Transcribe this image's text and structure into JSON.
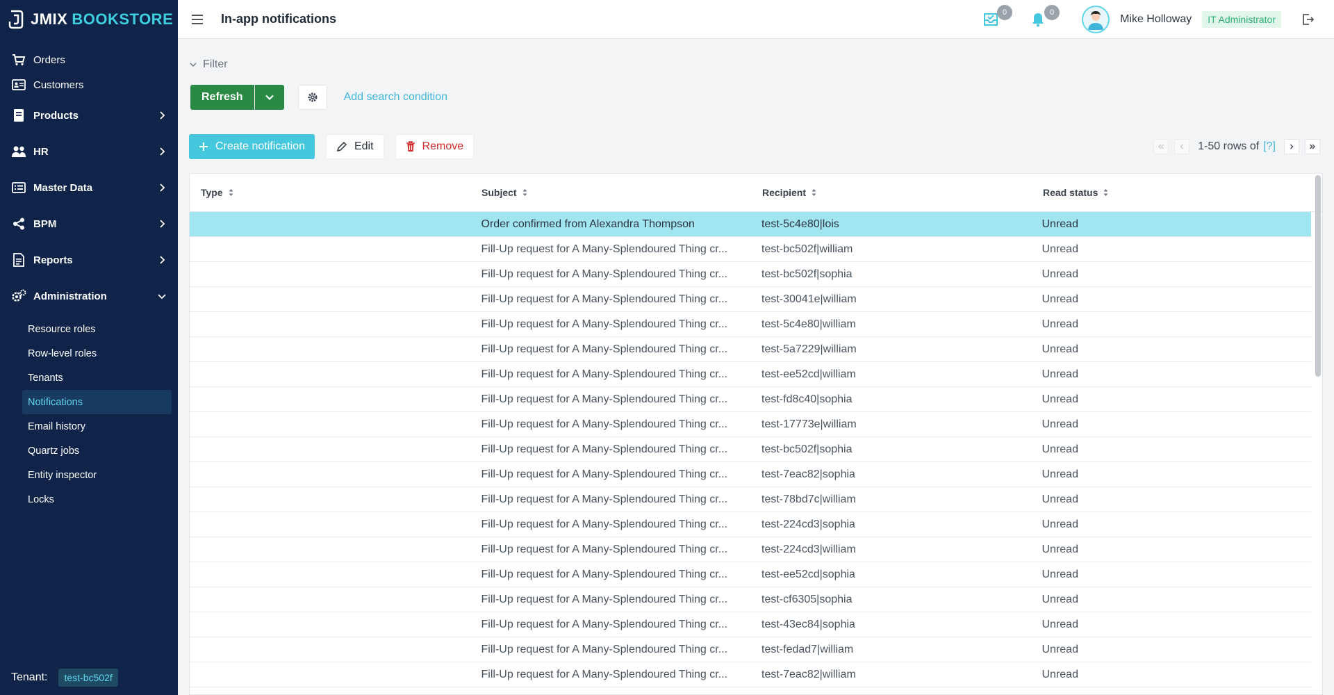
{
  "app": {
    "logo_word1": "JMIX",
    "logo_word2": "BOOKSTORE"
  },
  "sidebar": {
    "items": [
      {
        "label": "Orders",
        "icon": "cart-icon"
      },
      {
        "label": "Customers",
        "icon": "id-card-icon"
      }
    ],
    "groups": [
      {
        "label": "Products",
        "icon": "book-icon"
      },
      {
        "label": "HR",
        "icon": "users-icon"
      },
      {
        "label": "Master Data",
        "icon": "list-icon"
      },
      {
        "label": "BPM",
        "icon": "share-icon"
      },
      {
        "label": "Reports",
        "icon": "report-icon"
      },
      {
        "label": "Administration",
        "icon": "cogs-icon"
      }
    ],
    "admin_items": [
      "Resource roles",
      "Row-level roles",
      "Tenants",
      "Notifications",
      "Email history",
      "Quartz jobs",
      "Entity inspector",
      "Locks"
    ],
    "active_item": "Notifications",
    "tenant_label": "Tenant:",
    "tenant_value": "test-bc502f"
  },
  "header": {
    "title": "In-app notifications",
    "inbox_count": "0",
    "bell_count": "0",
    "user_name": "Mike Holloway",
    "role": "IT Administrator"
  },
  "filter": {
    "label": "Filter",
    "refresh_label": "Refresh",
    "add_condition_label": "Add search condition"
  },
  "toolbar": {
    "create_label": "Create notification",
    "edit_label": "Edit",
    "remove_label": "Remove"
  },
  "pager": {
    "range_text": "1-50 rows of",
    "total_link": "[?]"
  },
  "grid": {
    "columns": [
      "Type",
      "Subject",
      "Recipient",
      "Read status"
    ],
    "rows": [
      {
        "type": "",
        "subject": "Order confirmed from Alexandra Thompson",
        "recipient": "test-5c4e80|lois",
        "status": "Unread"
      },
      {
        "type": "",
        "subject": "Fill-Up request for A Many-Splendoured Thing cr...",
        "recipient": "test-bc502f|william",
        "status": "Unread"
      },
      {
        "type": "",
        "subject": "Fill-Up request for A Many-Splendoured Thing cr...",
        "recipient": "test-bc502f|sophia",
        "status": "Unread"
      },
      {
        "type": "",
        "subject": "Fill-Up request for A Many-Splendoured Thing cr...",
        "recipient": "test-30041e|william",
        "status": "Unread"
      },
      {
        "type": "",
        "subject": "Fill-Up request for A Many-Splendoured Thing cr...",
        "recipient": "test-5c4e80|william",
        "status": "Unread"
      },
      {
        "type": "",
        "subject": "Fill-Up request for A Many-Splendoured Thing cr...",
        "recipient": "test-5a7229|william",
        "status": "Unread"
      },
      {
        "type": "",
        "subject": "Fill-Up request for A Many-Splendoured Thing cr...",
        "recipient": "test-ee52cd|william",
        "status": "Unread"
      },
      {
        "type": "",
        "subject": "Fill-Up request for A Many-Splendoured Thing cr...",
        "recipient": "test-fd8c40|sophia",
        "status": "Unread"
      },
      {
        "type": "",
        "subject": "Fill-Up request for A Many-Splendoured Thing cr...",
        "recipient": "test-17773e|william",
        "status": "Unread"
      },
      {
        "type": "",
        "subject": "Fill-Up request for A Many-Splendoured Thing cr...",
        "recipient": "test-bc502f|sophia",
        "status": "Unread"
      },
      {
        "type": "",
        "subject": "Fill-Up request for A Many-Splendoured Thing cr...",
        "recipient": "test-7eac82|sophia",
        "status": "Unread"
      },
      {
        "type": "",
        "subject": "Fill-Up request for A Many-Splendoured Thing cr...",
        "recipient": "test-78bd7c|william",
        "status": "Unread"
      },
      {
        "type": "",
        "subject": "Fill-Up request for A Many-Splendoured Thing cr...",
        "recipient": "test-224cd3|sophia",
        "status": "Unread"
      },
      {
        "type": "",
        "subject": "Fill-Up request for A Many-Splendoured Thing cr...",
        "recipient": "test-224cd3|william",
        "status": "Unread"
      },
      {
        "type": "",
        "subject": "Fill-Up request for A Many-Splendoured Thing cr...",
        "recipient": "test-ee52cd|sophia",
        "status": "Unread"
      },
      {
        "type": "",
        "subject": "Fill-Up request for A Many-Splendoured Thing cr...",
        "recipient": "test-cf6305|sophia",
        "status": "Unread"
      },
      {
        "type": "",
        "subject": "Fill-Up request for A Many-Splendoured Thing cr...",
        "recipient": "test-43ec84|sophia",
        "status": "Unread"
      },
      {
        "type": "",
        "subject": "Fill-Up request for A Many-Splendoured Thing cr...",
        "recipient": "test-fedad7|william",
        "status": "Unread"
      },
      {
        "type": "",
        "subject": "Fill-Up request for A Many-Splendoured Thing cr...",
        "recipient": "test-7eac82|william",
        "status": "Unread"
      }
    ],
    "selected_row": 0
  },
  "colors": {
    "sidebar_bg": "#0f2448",
    "accent": "#45c7dd",
    "refresh_green": "#2a8a43",
    "remove_red": "#d12b2b",
    "selected_row": "#a0e5f0"
  }
}
